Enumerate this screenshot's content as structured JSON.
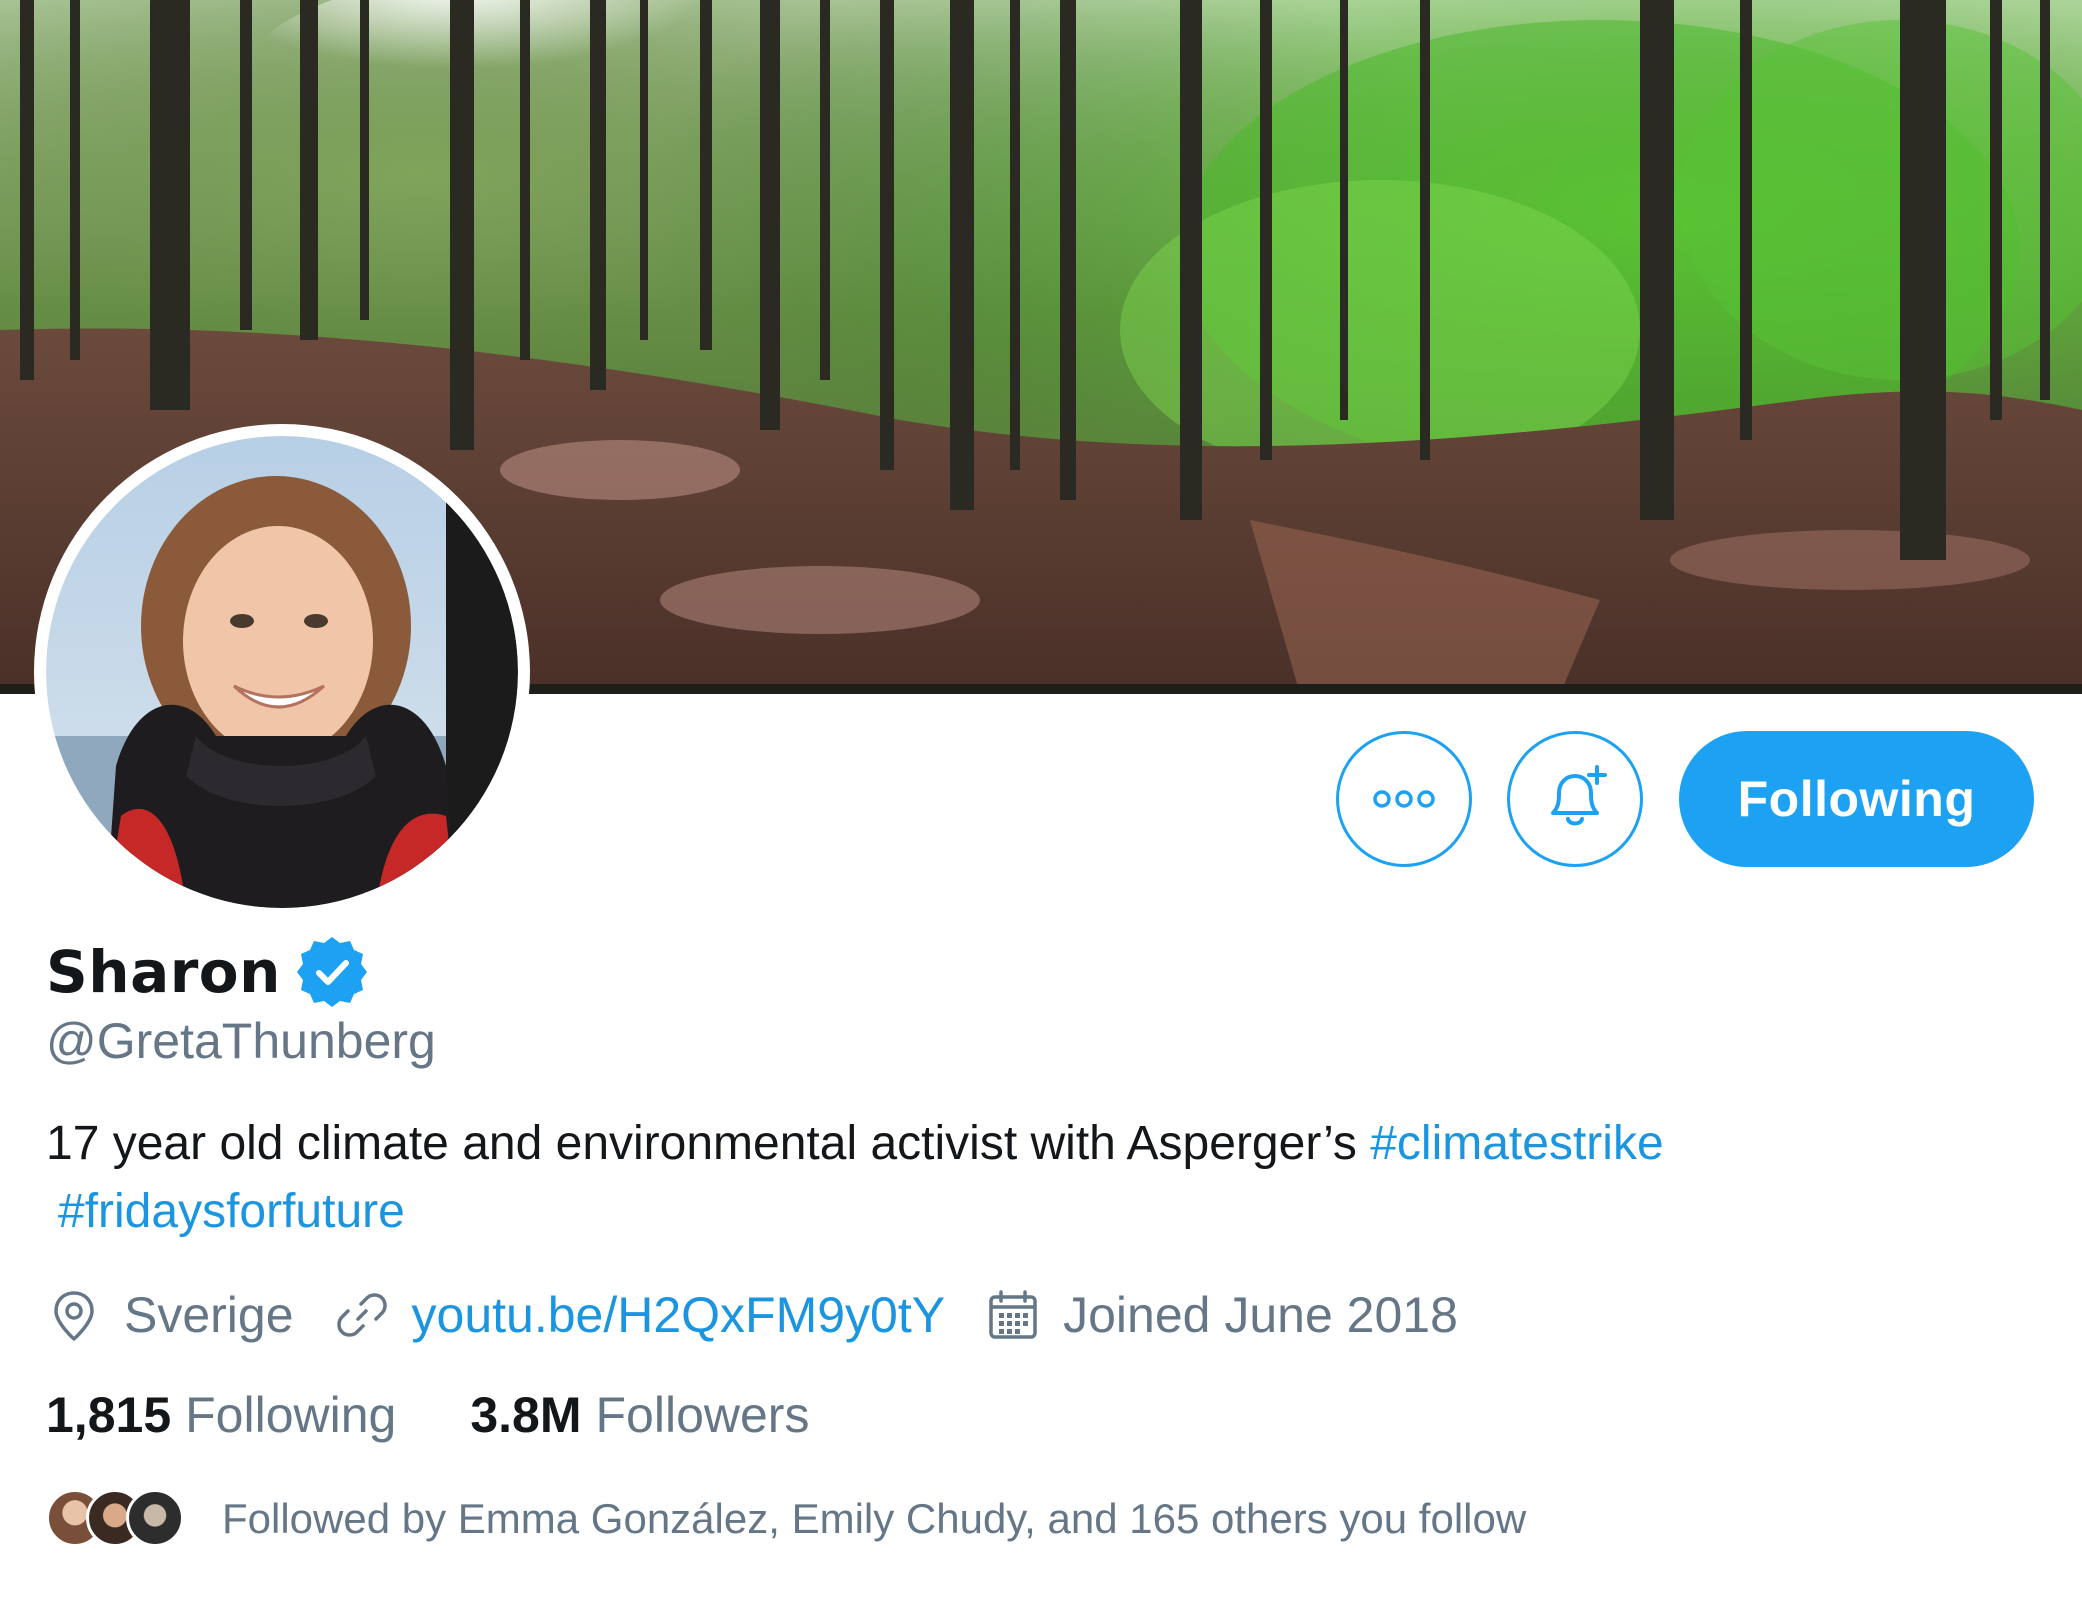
{
  "profile": {
    "display_name": "Sharon",
    "handle": "@GretaThunberg",
    "verified": true,
    "bio": {
      "text": "17 year old climate and environmental activist with Asperger’s ",
      "hashtags": [
        "#climatestrike",
        "#fridaysforfuture"
      ]
    },
    "location": "Sverige",
    "website": "youtu.be/H2QxFM9y0tY",
    "joined": "Joined June 2018"
  },
  "actions": {
    "more_icon": "more-icon",
    "notify_icon": "bell-plus-icon",
    "follow_label": "Following"
  },
  "stats": {
    "following_count": "1,815",
    "following_label": "Following",
    "followers_count": "3.8M",
    "followers_label": "Followers"
  },
  "followed_by": {
    "text": "Followed by Emma González, Emily Chudy, and 165 others you follow"
  },
  "colors": {
    "accent": "#1da1f2",
    "link": "#1b95e0",
    "secondary_text": "#657786",
    "primary_text": "#14171a"
  }
}
